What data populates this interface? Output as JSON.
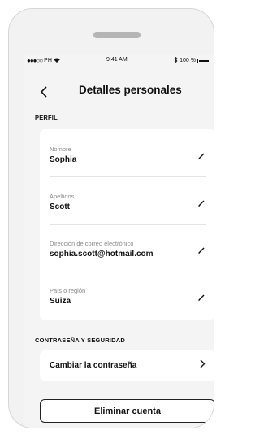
{
  "status_bar": {
    "carrier": "PH",
    "time": "9:41 AM",
    "battery": "100 %"
  },
  "header": {
    "back_icon": "chevron-left-icon",
    "title": "Detalles personales"
  },
  "profile": {
    "section_title": "PERFIL",
    "fields": [
      {
        "label": "Nombre",
        "value": "Sophia"
      },
      {
        "label": "Apellidos",
        "value": "Scott"
      },
      {
        "label": "Dirección de correo electrónico",
        "value": "sophia.scott@hotmail.com"
      },
      {
        "label": "País o región",
        "value": "Suiza"
      }
    ]
  },
  "security": {
    "section_title": "CONTRASEÑA Y SEGURIDAD",
    "change_password_label": "Cambiar la contraseña",
    "chevron_icon": "chevron-right-icon"
  },
  "delete_account_label": "Eliminar cuenta"
}
